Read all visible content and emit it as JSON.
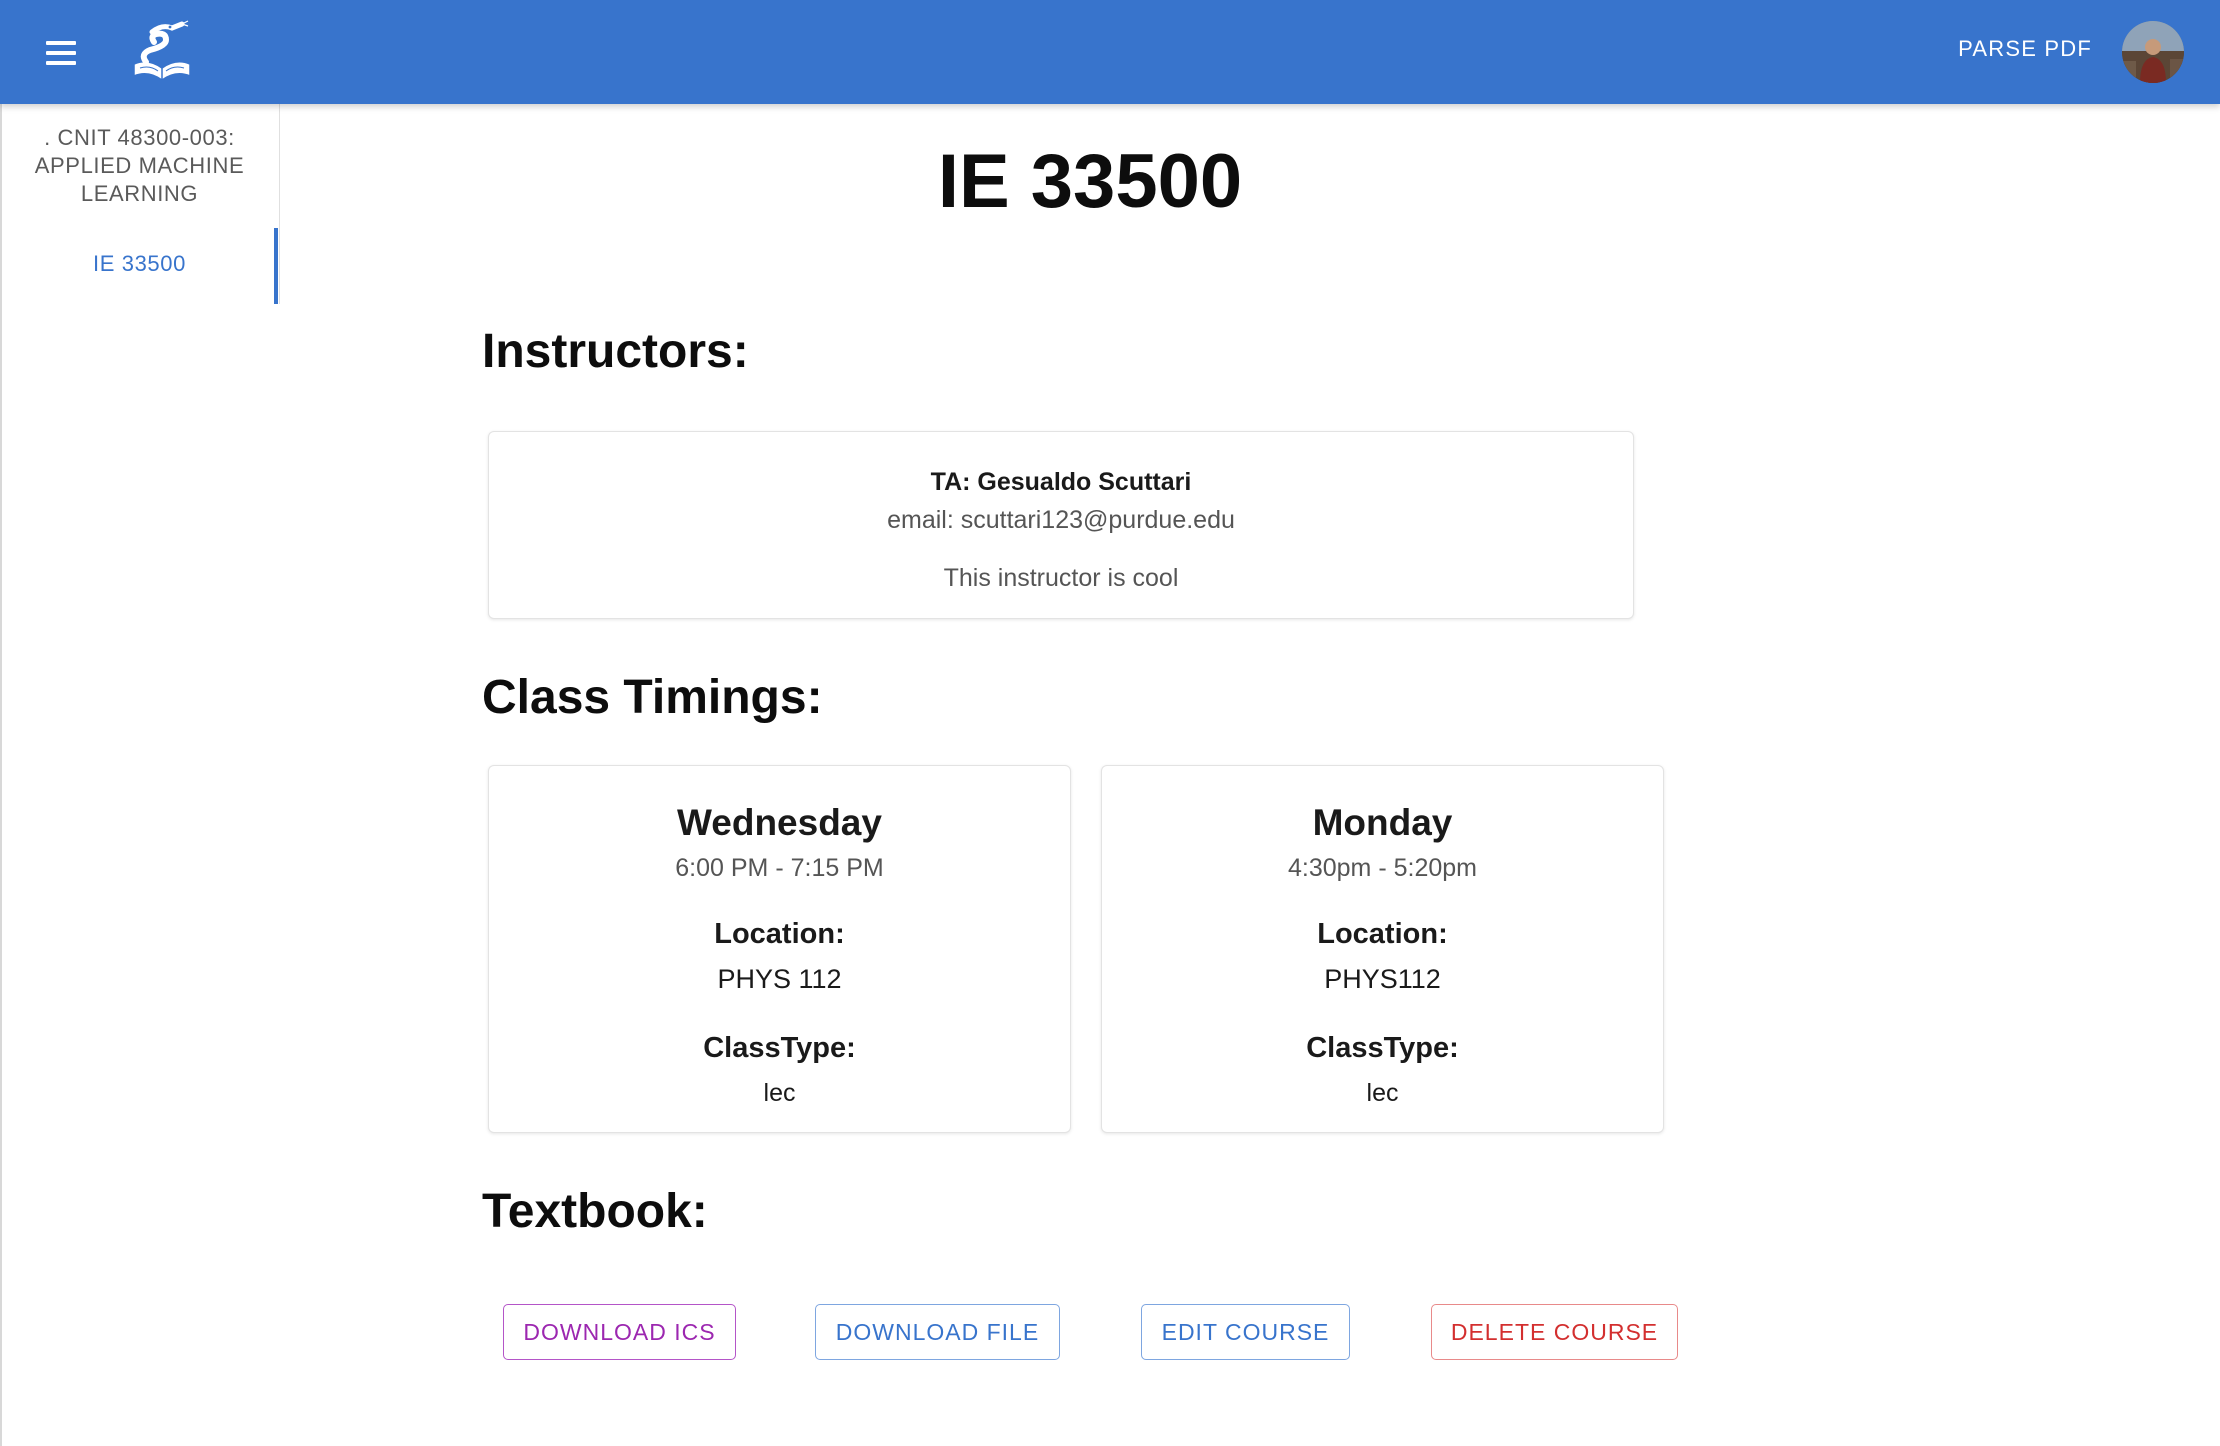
{
  "appbar": {
    "action_label": "PARSE PDF",
    "color": "#3874cc",
    "menu_icon": "hamburger-menu-icon",
    "logo_icon": "snake-on-book-logo"
  },
  "sidebar": {
    "items": [
      {
        "label": ". CNIT 48300-003: APPLIED MACHINE LEARNING",
        "active": false
      },
      {
        "label": "IE 33500",
        "active": true
      }
    ]
  },
  "course": {
    "title": "IE 33500"
  },
  "instructors": {
    "heading": "Instructors:",
    "list": [
      {
        "name": "TA: Gesualdo Scuttari",
        "email": "email: scuttari123@purdue.edu",
        "note": "This instructor is cool"
      }
    ]
  },
  "timings": {
    "heading": "Class Timings:",
    "location_label": "Location:",
    "classtype_label": "ClassType:",
    "list": [
      {
        "day": "Wednesday",
        "time": "6:00 PM - 7:15 PM",
        "location": "PHYS 112",
        "class_type": "lec"
      },
      {
        "day": "Monday",
        "time": "4:30pm - 5:20pm",
        "location": "PHYS112",
        "class_type": "lec"
      }
    ]
  },
  "textbook": {
    "heading": "Textbook:"
  },
  "actions": {
    "download_ics": "DOWNLOAD ICS",
    "download_file": "DOWNLOAD FILE",
    "edit_course": "EDIT COURSE",
    "delete_course": "DELETE COURSE"
  },
  "colors": {
    "primary": "#3874cc",
    "secondary": "#9c27b0",
    "error": "#d32f2f"
  }
}
